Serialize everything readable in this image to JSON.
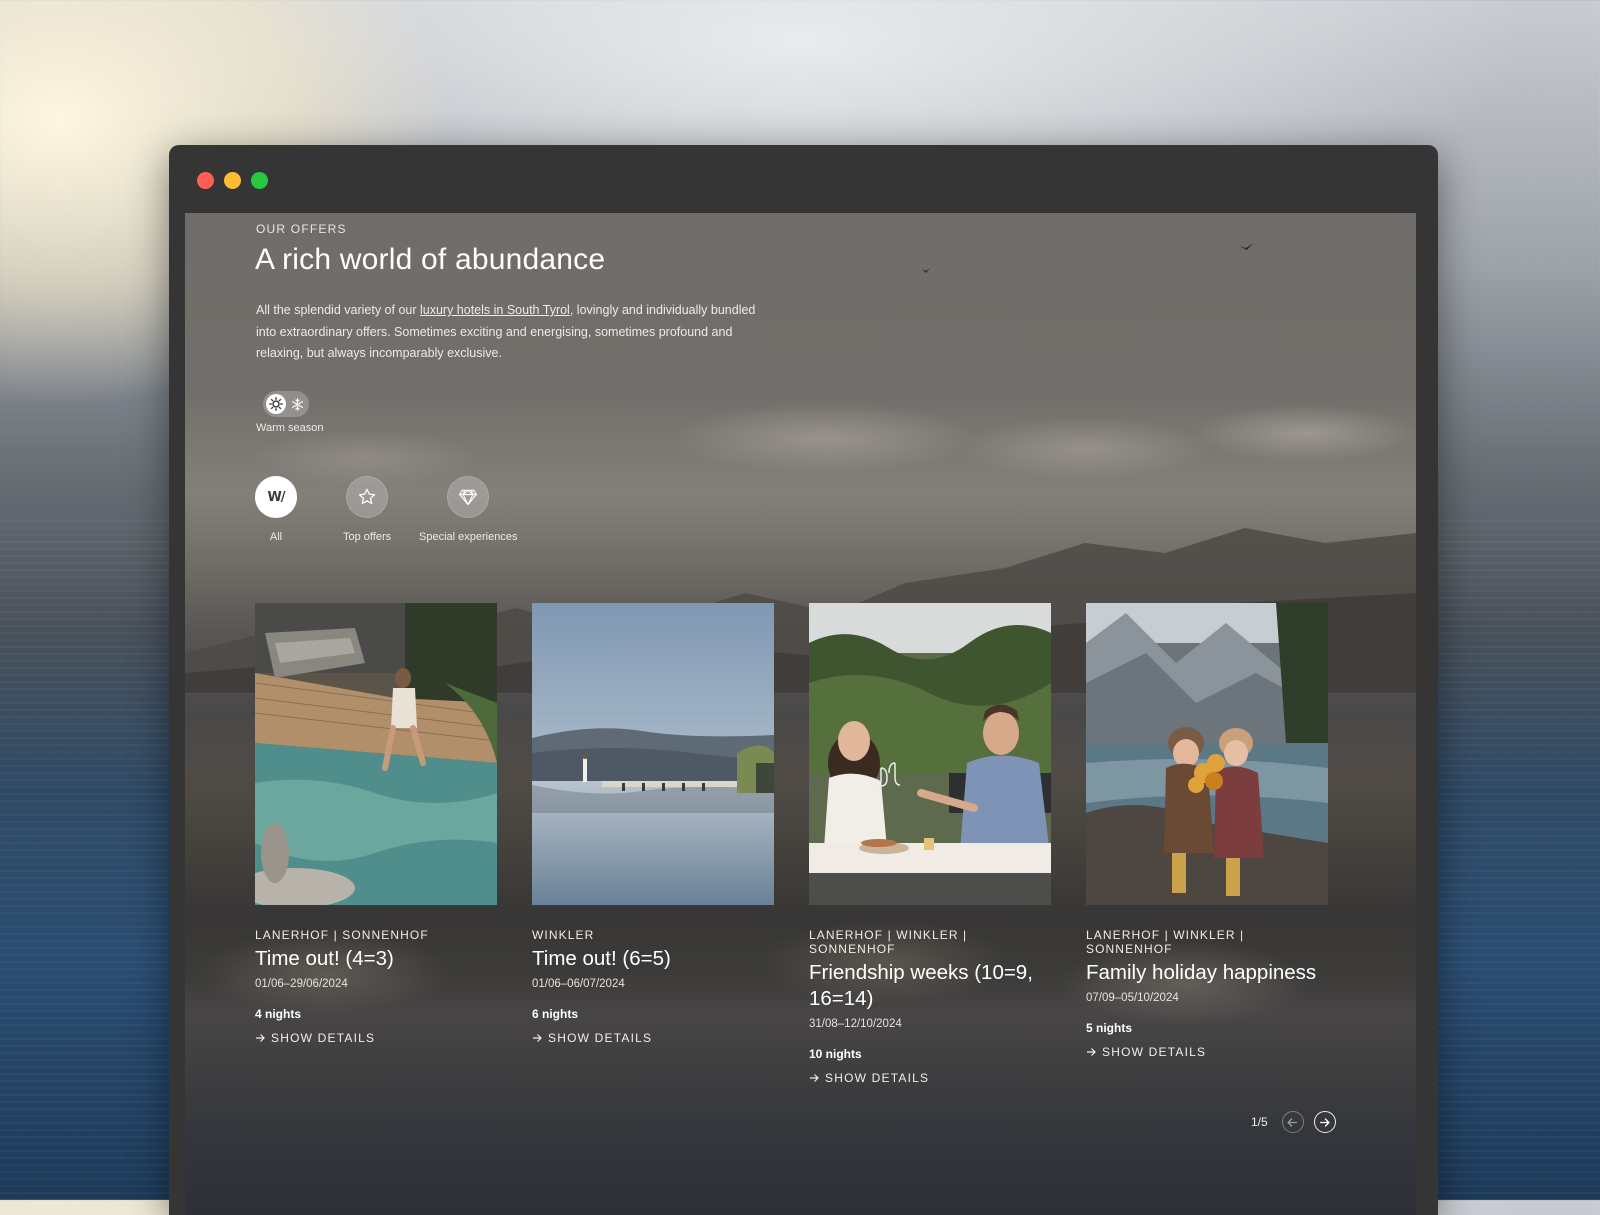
{
  "colors": {
    "close": "#ff5f57",
    "minimize": "#febc2e",
    "maximize": "#28c840",
    "window_chrome": "#363536"
  },
  "page": {
    "eyebrow": "OUR OFFERS",
    "title": "A rich world of abundance",
    "intro_before": "All the splendid variety of our ",
    "intro_link": "luxury hotels in South Tyrol",
    "intro_after": ", lovingly and individually bundled into extraordinary offers. Sometimes exciting and energising, sometimes profound and relaxing, but always incomparably exclusive."
  },
  "season": {
    "label": "Warm season",
    "active_icon": "sun-icon",
    "inactive_icon": "snowflake-icon"
  },
  "categories": [
    {
      "label": "All",
      "icon": "w-logo-icon",
      "active": true
    },
    {
      "label": "Top offers",
      "icon": "star-icon",
      "active": false
    },
    {
      "label": "Special experiences",
      "icon": "diamond-icon",
      "active": false
    }
  ],
  "offers": [
    {
      "hotels": "LANERHOF | SONNENHOF",
      "title": "Time out! (4=3)",
      "dates": "01/06–29/06/2024",
      "nights": "4 nights",
      "cta": "SHOW DETAILS",
      "image": "woman-at-pool-photo"
    },
    {
      "hotels": "WINKLER",
      "title": "Time out! (6=5)",
      "dates": "01/06–06/07/2024",
      "nights": "6 nights",
      "cta": "SHOW DETAILS",
      "image": "infinity-pool-lake-photo"
    },
    {
      "hotels": "LANERHOF | WINKLER | SONNENHOF",
      "title": "Friendship weeks (10=9, 16=14)",
      "dates": "31/08–12/10/2024",
      "nights": "10 nights",
      "cta": "SHOW DETAILS",
      "image": "couple-dining-photo"
    },
    {
      "hotels": "LANERHOF | WINKLER | SONNENHOF",
      "title": "Family holiday happiness",
      "dates": "07/09–05/10/2024",
      "nights": "5 nights",
      "cta": "SHOW DETAILS",
      "image": "children-by-mountain-lake-photo"
    }
  ],
  "pagination": {
    "current": "1/5"
  }
}
